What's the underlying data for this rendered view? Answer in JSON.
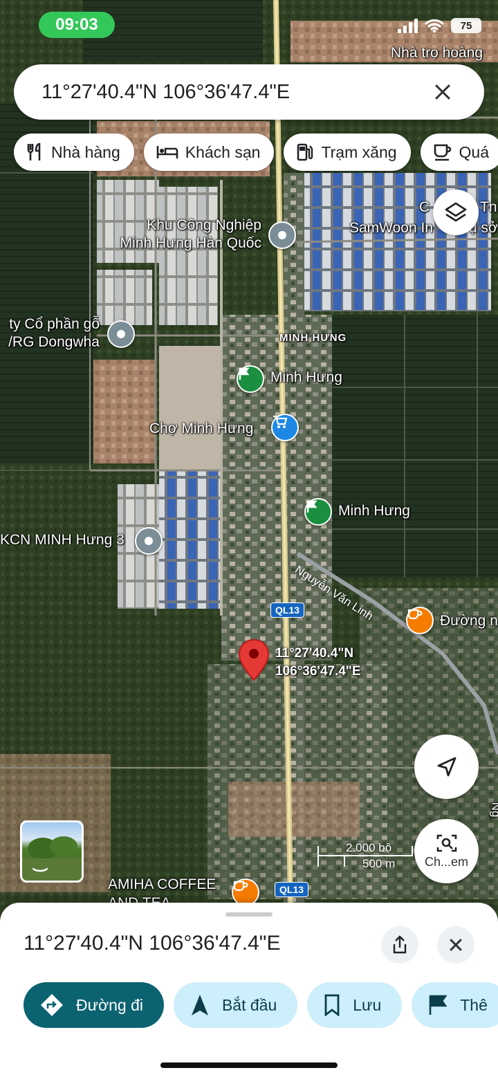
{
  "status_bar": {
    "time": "09:03",
    "battery": "75"
  },
  "search": {
    "query": "11°27'40.4\"N 106°36'47.4\"E"
  },
  "chips": [
    {
      "icon": "restaurant-icon",
      "label": "Nhà hàng"
    },
    {
      "icon": "hotel-icon",
      "label": "Khách sạn"
    },
    {
      "icon": "gas-station-icon",
      "label": "Trạm xăng"
    },
    {
      "icon": "coffee-icon",
      "label": "Quá"
    }
  ],
  "map": {
    "labels": {
      "nha_tro": "Nhà trọ hoàng",
      "cty_tnhh_top": "C",
      "cty_tnhh_top2": "Tn",
      "samwoon": "SamWoon In",
      "samwoon2": "ụ sở",
      "kcn_minh_hung_hq_line1": "Khu Công Nghiệp",
      "kcn_minh_hung_hq_line2": "Minh Hưng Hàn Quốc",
      "dongwha_line1": "ty Cổ phần gỗ",
      "dongwha_line2": "/RG Dongwha",
      "area_minh_hung": "MINH HƯNG",
      "minh_hung_1": "Minh Hưng",
      "cho_minh_hung": "Chợ Minh Hưng",
      "minh_hung_2": "Minh Hưng",
      "kcn_minh_hung_3": "KCN MINH Hưng 3",
      "road_nguyen_van_linh": "Nguyễn Văn Linh",
      "duong": "Đường n",
      "route_shield": "QL13",
      "route_shield_2": "QL13",
      "pin_line1": "11°27'40.4\"N",
      "pin_line2": "106°36'47.4\"E",
      "amiha_line1": "AMIHA COFFEE",
      "amiha_line2": "AND TEA",
      "side_road": "Ng"
    },
    "scale": {
      "imperial": "2.000 bộ",
      "metric": "500 m"
    },
    "lens_label": "Ch...em"
  },
  "sheet": {
    "title": "11°27'40.4\"N 106°36'47.4\"E",
    "actions": [
      {
        "icon": "directions-icon",
        "label": "Đường đi"
      },
      {
        "icon": "navigation-arrow-icon",
        "label": "Bắt đầu"
      },
      {
        "icon": "bookmark-icon",
        "label": "Lưu"
      },
      {
        "icon": "flag-icon",
        "label": "Thê"
      }
    ]
  },
  "colors": {
    "primary_action": "#0b6270",
    "secondary_action": "#cdeefb",
    "pin": "#e53935",
    "status_time_bg": "#34c759"
  }
}
